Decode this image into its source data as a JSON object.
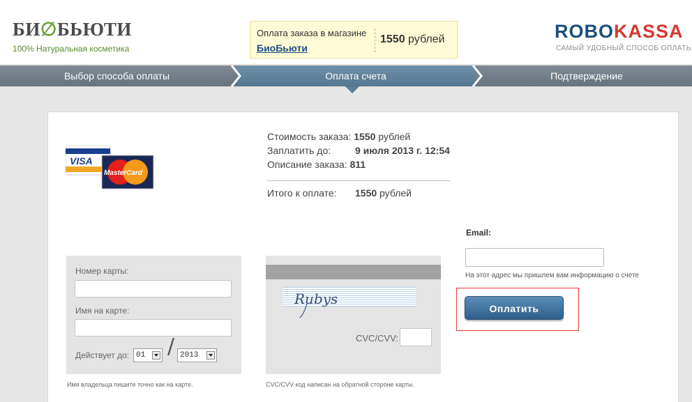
{
  "header": {
    "logo_title": "БИ&БЬЮТИ",
    "logo_part1": "БИ",
    "logo_part2": "БЬЮТИ",
    "logo_subtitle": "100% Натуральная косметика",
    "order_line": "Оплата заказа в магазине",
    "shop_link": "БиоБьюти",
    "price_amount": "1550",
    "price_unit": "рублей",
    "rk_part1": "ROBO",
    "rk_part2": "KASSA",
    "rk_slogan": "САМЫЙ УДОБНЫЙ СПОСОБ ОПЛАТЬ"
  },
  "steps": {
    "step1": "Выбор способа оплаты",
    "step2": "Оплата счета",
    "step3": "Подтверждение"
  },
  "summary": {
    "cost_label": "Стоимость заказа:",
    "cost_amount": "1550",
    "cost_unit": "рублей",
    "deadline_label": "Заплатить до:",
    "deadline_value": "9 июля 2013 г. 12:54",
    "desc_label": "Описание заказа:",
    "desc_value": "811",
    "total_label": "Итого к оплате:",
    "total_amount": "1550",
    "total_unit": "рублей"
  },
  "card_logos": {
    "visa": "VISA",
    "mastercard": "MasterCard"
  },
  "form": {
    "card_number_label": "Номер карты:",
    "card_name_label": "Имя на карте:",
    "valid_label": "Действует до:",
    "month": "01",
    "year": "2013",
    "slash": "/",
    "cvc_label": "CVC/CVV:",
    "signature": "Rubys",
    "note_front": "Имя владельца пишите точно как на карте.",
    "note_back": "CVC/CVV код написан на обратной стороне карты."
  },
  "email": {
    "label": "Email:",
    "note": "На этот адрес мы пришлем вам информацию о счете"
  },
  "pay_button": "Оплатить",
  "colors": {
    "accent": "#2d5f8a",
    "brand_green": "#6aa33a",
    "brand_red": "#d43a2f",
    "highlight_frame": "#e33333"
  }
}
